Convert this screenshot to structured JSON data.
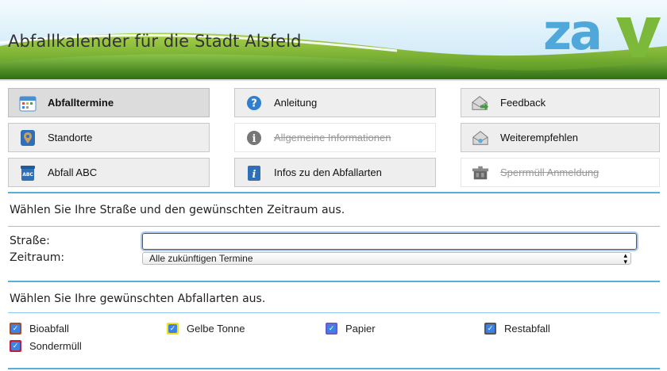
{
  "header": {
    "title": "Abfallkalender für die Stadt Alsfeld",
    "logo_text": "zav"
  },
  "colors": {
    "accent_line": "#5aaedc",
    "logo_blue": "#4fa8d9",
    "logo_green": "#7cb83a",
    "checkbox_blue": "#3d82e5"
  },
  "nav": {
    "items": [
      {
        "label": "Abfalltermine",
        "icon": "calendar-icon",
        "state": "active"
      },
      {
        "label": "Anleitung",
        "icon": "help-icon",
        "state": "normal"
      },
      {
        "label": "Feedback",
        "icon": "feedback-icon",
        "state": "normal"
      },
      {
        "label": "Standorte",
        "icon": "location-icon",
        "state": "normal"
      },
      {
        "label": "Allgemeine Informationen",
        "icon": "info-icon",
        "state": "disabled"
      },
      {
        "label": "Weiterempfehlen",
        "icon": "recommend-icon",
        "state": "normal"
      },
      {
        "label": "Abfall ABC",
        "icon": "abc-icon",
        "state": "normal"
      },
      {
        "label": "Infos zu den Abfallarten",
        "icon": "info-card-icon",
        "state": "normal"
      },
      {
        "label": "Sperrmüll Anmeldung",
        "icon": "bulky-waste-icon",
        "state": "disabled"
      }
    ]
  },
  "step1": {
    "heading": "Wählen Sie Ihre Straße und den gewünschten Zeitraum aus.",
    "street_label": "Straße:",
    "street_value": "",
    "period_label": "Zeitraum:",
    "period_value": "Alle zukünftigen Termine"
  },
  "step2": {
    "heading": "Wählen Sie Ihre gewünschten Abfallarten aus.",
    "types": [
      {
        "label": "Bioabfall",
        "checked": true,
        "color": "#a0522d"
      },
      {
        "label": "Gelbe Tonne",
        "checked": true,
        "color": "#f2e21b"
      },
      {
        "label": "Papier",
        "checked": true,
        "color": "#3d82e5"
      },
      {
        "label": "Restabfall",
        "checked": true,
        "color": "#555555"
      },
      {
        "label": "Sondermüll",
        "checked": true,
        "color": "#c0203a"
      }
    ]
  }
}
